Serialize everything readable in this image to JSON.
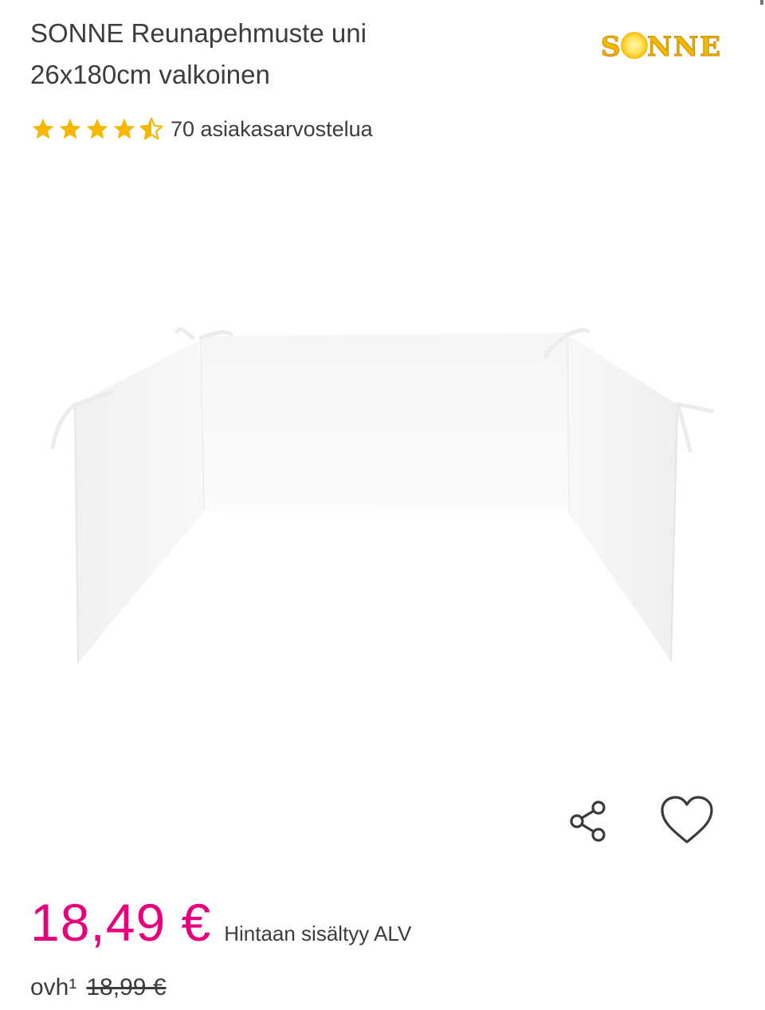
{
  "product": {
    "title_line1": "SONNE Reunapehmuste uni",
    "title_line2": "26x180cm valkoinen",
    "brand": "SONNE"
  },
  "rating": {
    "stars_value": 4.5,
    "stars_max": 5,
    "review_text": "70 asiakasarvostelua",
    "star_color": "#f5b700"
  },
  "icons": {
    "share": "share-icon",
    "wishlist": "heart-icon"
  },
  "pricing": {
    "price": "18,49 €",
    "vat_note": "Hintaan sisältyy ALV",
    "old_price_label": "ovh¹",
    "old_price": "18,99 €",
    "price_color": "#e5007d"
  }
}
